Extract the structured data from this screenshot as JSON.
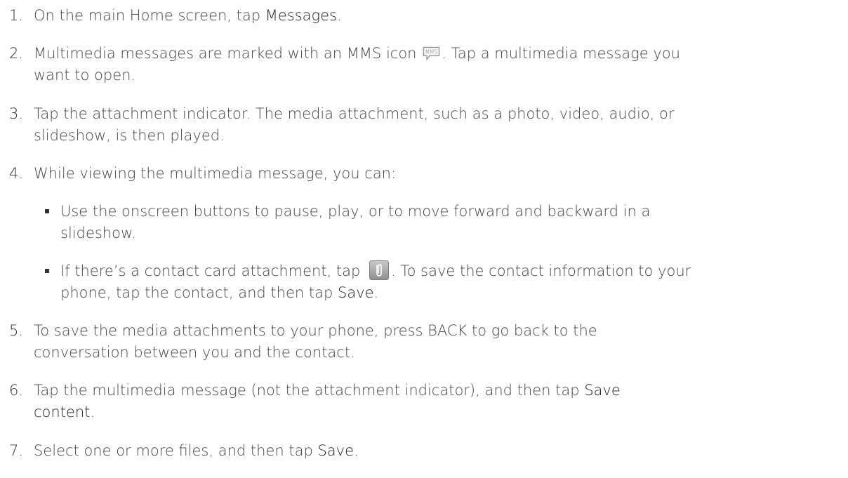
{
  "steps": [
    {
      "num": "1.",
      "text_a": "On the main Home screen, tap ",
      "hl_a": "Messages",
      "text_b": "."
    },
    {
      "num": "2.",
      "text_a": "Multimedia messages are marked with an MMS icon ",
      "text_b": ". Tap a multimedia message you",
      "text_c": "want to open."
    },
    {
      "num": "3.",
      "text_a": "Tap the attachment indicator. The media attachment, such as a photo, video, audio, or",
      "text_b": "slideshow, is then played."
    },
    {
      "num": "4.",
      "text_a": "While viewing the multimedia message, you can:"
    },
    {
      "num": "5.",
      "text_a": "To save the media attachments to your phone, press BACK to go back to the",
      "text_b": "conversation between you and the contact."
    },
    {
      "num": "6.",
      "text_a": "Tap the multimedia message (not the attachment indicator), and then tap ",
      "hl_a": "Save",
      "hl_b": "content",
      "text_b": "."
    },
    {
      "num": "7.",
      "text_a": "Select one or more files, and then tap ",
      "hl_a": "Save",
      "text_b": "."
    }
  ],
  "bullets": [
    {
      "text_a": "Use the onscreen buttons to pause, play, or to move forward and backward in a",
      "text_b": "slideshow."
    },
    {
      "text_a": "If there’s a contact card attachment, tap ",
      "text_b": ". To save the contact information to your",
      "text_c": "phone, tap the contact, and then tap ",
      "hl_a": "Save.",
      "text_d": ""
    }
  ],
  "icons": {
    "mms": "mms-icon",
    "attachment": "paperclip-icon"
  },
  "icon_labels": {
    "mms": "MMS"
  },
  "colors": {
    "text": "#444444",
    "highlight": "#222222",
    "bullet": "#333333"
  }
}
